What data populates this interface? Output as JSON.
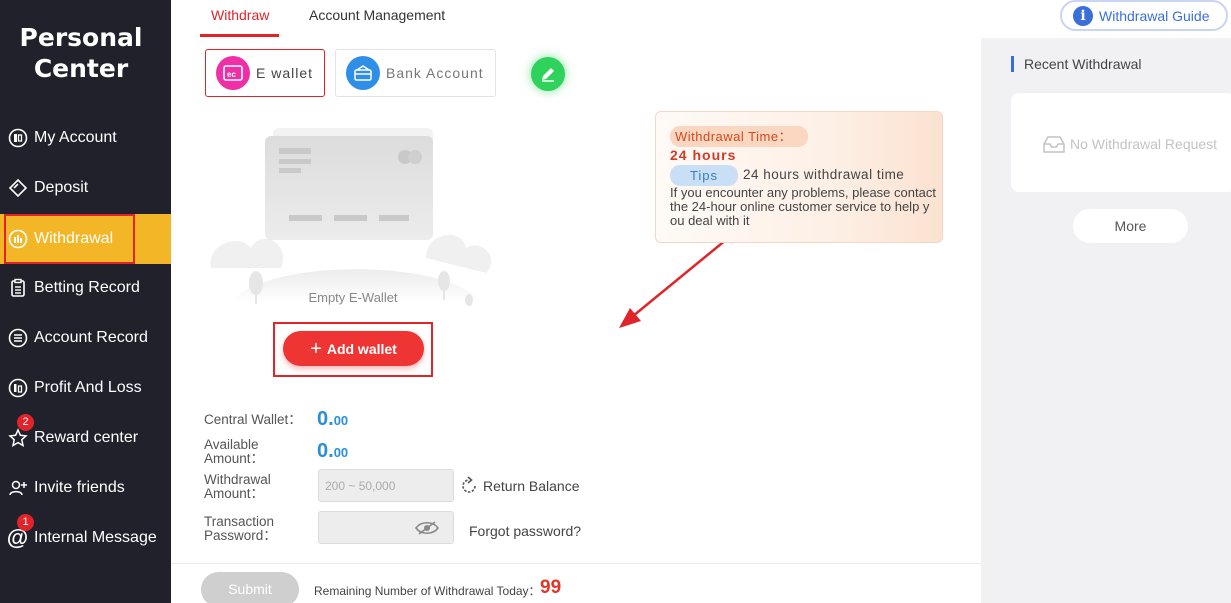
{
  "sidebar": {
    "title": "Personal Center",
    "items": [
      {
        "label": "My Account",
        "icon": "account-icon"
      },
      {
        "label": "Deposit",
        "icon": "deposit-icon"
      },
      {
        "label": "Withdrawal",
        "icon": "withdrawal-icon",
        "active": true
      },
      {
        "label": "Betting Record",
        "icon": "clipboard-icon"
      },
      {
        "label": "Account Record",
        "icon": "list-icon"
      },
      {
        "label": "Profit And Loss",
        "icon": "profit-icon"
      },
      {
        "label": "Reward center",
        "icon": "star-icon",
        "badge": "2"
      },
      {
        "label": "Invite friends",
        "icon": "invite-icon"
      },
      {
        "label": "Internal Message",
        "icon": "at-icon",
        "badge": "1"
      }
    ]
  },
  "topbar": {
    "tabs": [
      {
        "label": "Withdraw",
        "active": true
      },
      {
        "label": "Account Management"
      }
    ],
    "guide_label": "Withdrawal Guide"
  },
  "wallet_types": [
    {
      "label": "E wallet",
      "active": true
    },
    {
      "label": "Bank Account"
    }
  ],
  "empty_wallet_label": "Empty E-Wallet",
  "add_wallet_label": "Add wallet",
  "tips": {
    "time_title": "Withdrawal Time：",
    "time_value": "24 hours",
    "tips_label": "Tips",
    "tips_line": "24 hours withdrawal time",
    "help_text": "If you encounter any problems, please contact the 24-hour online customer service to help you deal with it"
  },
  "form": {
    "central_wallet_label": "Central Wallet：",
    "central_wallet_int": "0.",
    "central_wallet_dec": "00",
    "available_label": "Available Amount：",
    "available_int": "0.",
    "available_dec": "00",
    "withdrawal_label": "Withdrawal Amount：",
    "withdrawal_placeholder": "200 ~ 50,000",
    "return_balance": "Return Balance",
    "password_label": "Transaction Password：",
    "forgot_password": "Forgot password?"
  },
  "footer": {
    "submit_label": "Submit",
    "remaining_label": "Remaining Number of Withdrawal Today：",
    "remaining_value": "99"
  },
  "recent": {
    "title": "Recent Withdrawal",
    "empty": "No Withdrawal Request",
    "more_label": "More"
  },
  "colors": {
    "sidebar_bg": "#20212b",
    "active_item": "#f3b626",
    "accent_red": "#e0242a",
    "link_blue": "#3a6fd8",
    "value_blue": "#2a8fd6"
  }
}
